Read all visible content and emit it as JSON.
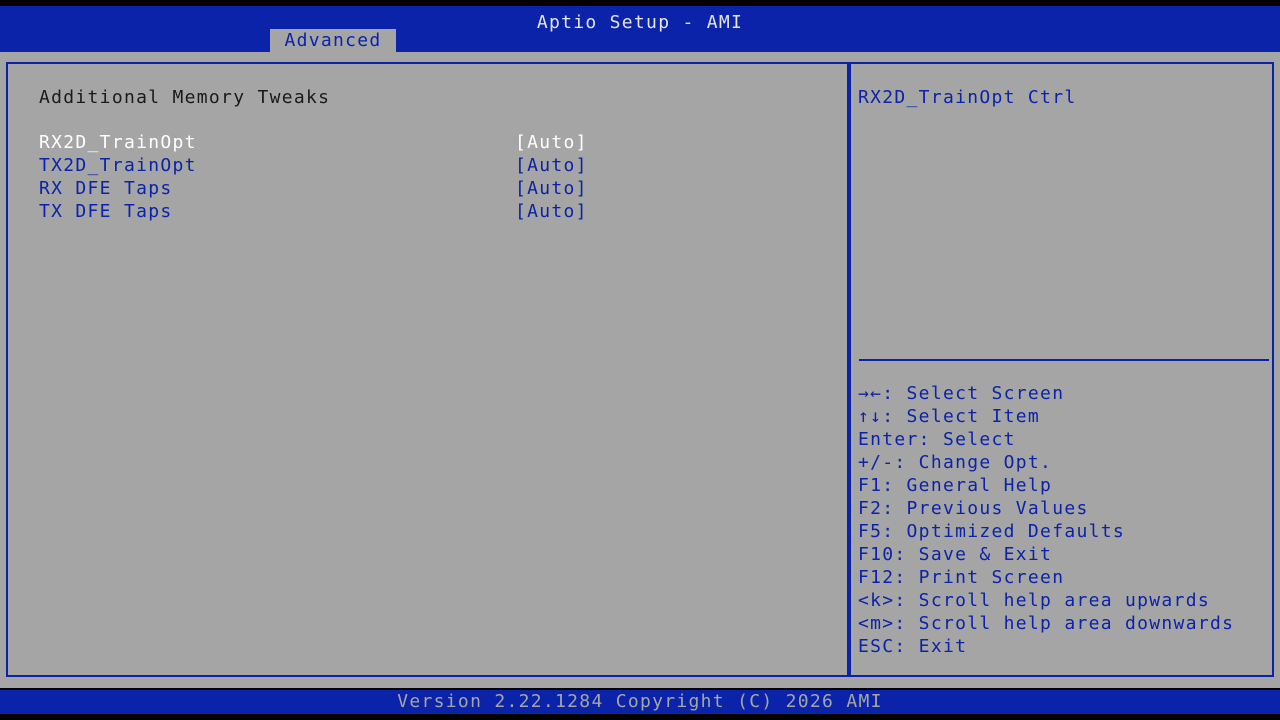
{
  "header": {
    "title": "Aptio Setup - AMI",
    "active_tab": "Advanced"
  },
  "main": {
    "section_title": "Additional Memory Tweaks",
    "items": [
      {
        "label": "RX2D_TrainOpt",
        "value": "[Auto]",
        "selected": true
      },
      {
        "label": "TX2D_TrainOpt",
        "value": "[Auto]",
        "selected": false
      },
      {
        "label": "RX DFE Taps",
        "value": "[Auto]",
        "selected": false
      },
      {
        "label": "TX DFE Taps",
        "value": "[Auto]",
        "selected": false
      }
    ]
  },
  "help": {
    "title": "RX2D_TrainOpt Ctrl",
    "keys": [
      "→←: Select Screen",
      "↑↓: Select Item",
      "Enter: Select",
      "+/-: Change Opt.",
      "F1: General Help",
      "F2: Previous Values",
      "F5: Optimized Defaults",
      "F10: Save & Exit",
      "F12: Print Screen",
      "<k>: Scroll help area upwards",
      "<m>: Scroll help area downwards",
      "ESC: Exit"
    ]
  },
  "footer": {
    "version": "Version 2.22.1284 Copyright (C) 2026 AMI"
  },
  "colors": {
    "bios_blue": "#0a23a8",
    "panel_gray": "#a5a5a5",
    "selected_text": "#ffffff",
    "dark_text": "#1a1a1a"
  }
}
